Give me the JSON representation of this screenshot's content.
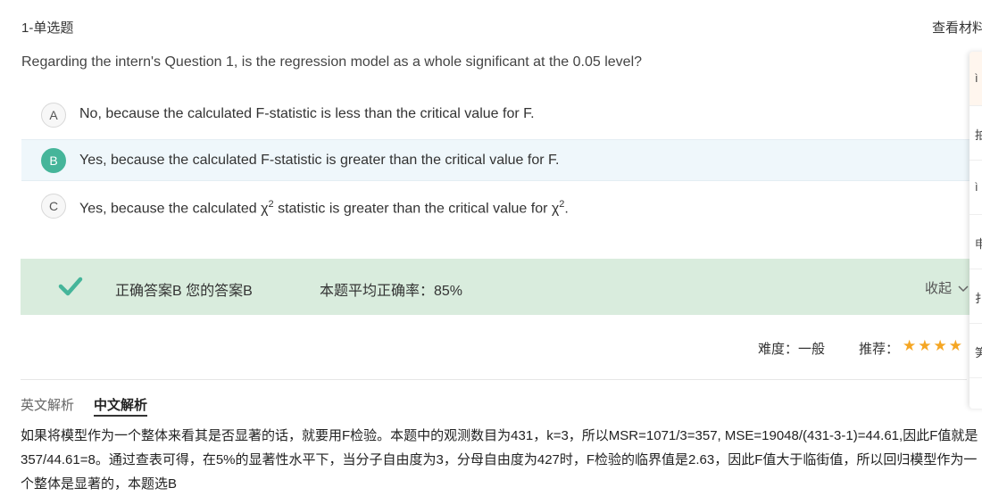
{
  "header": {
    "question_type": "1-单选题",
    "view_material": "查看材料"
  },
  "question": {
    "text": "Regarding the intern's Question 1, is the regression model as a whole significant at the 0.05 level?"
  },
  "options": [
    {
      "letter": "A",
      "text": "No, because the calculated F-statistic is less than the critical value for F.",
      "selected": false
    },
    {
      "letter": "B",
      "text": "Yes, because the calculated F-statistic is greater than the critical value for F.",
      "selected": true
    },
    {
      "letter": "C",
      "text_before": "Yes, because the calculated χ",
      "sup1": "2",
      "text_middle": " statistic is greater than the critical value for χ",
      "sup2": "2",
      "text_after": ".",
      "selected": false
    }
  ],
  "result": {
    "answer_text": "正确答案B 您的答案B",
    "accuracy_text": "本题平均正确率：85%",
    "collapse_label": "收起",
    "bar_color": "#d9ecdd",
    "check_color": "#45b59a"
  },
  "meta": {
    "difficulty": "难度：一般",
    "recommend_label": "推荐：",
    "stars": "★★★★",
    "star_color": "#f5a623"
  },
  "tabs": {
    "english": "英文解析",
    "chinese": "中文解析"
  },
  "analysis": {
    "text": "如果将模型作为一个整体来看其是否显著的话，就要用F检验。本题中的观测数目为431，k=3，所以MSR=1071/3=357, MSE=19048/(431-3-1)=44.61,因此F值就是357/44.61=8。通过查表可得，在5%的显著性水平下，当分子自由度为3，分母自由度为427时，F检验的临界值是2.63，因此F值大于临街值，所以回归模型作为一个整体是显著的，本题选B"
  },
  "side_panel": {
    "items": [
      "ì",
      "拍",
      "ì",
      "申",
      "扌",
      "笋"
    ]
  }
}
